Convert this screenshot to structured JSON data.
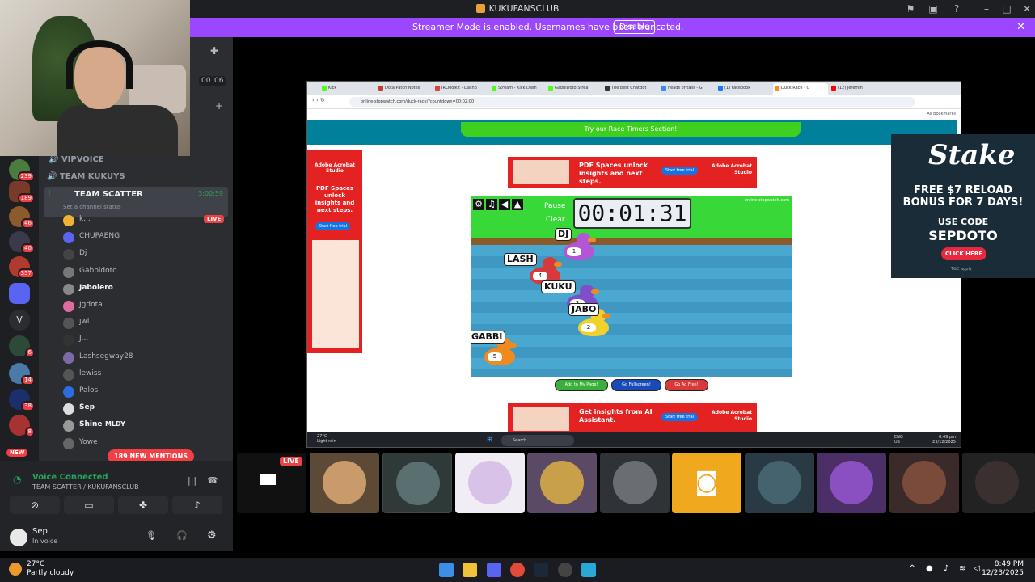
{
  "window": {
    "title": "KUKUFANSCLUB"
  },
  "banner": {
    "message": "Streamer Mode is enabled. Usernames have been truncated.",
    "disable_label": "Disable"
  },
  "server_rail": {
    "badges": [
      "239",
      "189",
      "46",
      "40",
      "357",
      "6",
      "14",
      "38",
      "8"
    ],
    "letter_server": "V",
    "new_label": "NEW"
  },
  "channels": {
    "timer_digits": [
      "00",
      "06"
    ],
    "categories": [
      {
        "name": "VIPVOICE"
      },
      {
        "name": "TEAM KUKUYS"
      }
    ],
    "active_channel": {
      "name": "TEAM SCATTER",
      "time": "3:00:59",
      "status": "Set a channel status"
    },
    "members": [
      {
        "name": "k...",
        "live": "LIVE",
        "color": "#f0b232",
        "bold": false
      },
      {
        "name": "CHUPAENG",
        "color": "#5865f2",
        "bold": false
      },
      {
        "name": "Dj",
        "color": "#444",
        "bold": false
      },
      {
        "name": "Gabbidoto",
        "color": "#777",
        "bold": false
      },
      {
        "name": "Jabolero",
        "color": "#888",
        "bold": true
      },
      {
        "name": "Jgdota",
        "color": "#e06c9f",
        "bold": false
      },
      {
        "name": "jwl",
        "color": "#555",
        "bold": false
      },
      {
        "name": "J...",
        "color": "#333",
        "bold": false
      },
      {
        "name": "Lashsegway28",
        "color": "#7b6aa5",
        "bold": false
      },
      {
        "name": "lewiss",
        "color": "#555",
        "bold": false
      },
      {
        "name": "Palos",
        "color": "#2d6cdf",
        "bold": false
      },
      {
        "name": "Sep",
        "color": "#ddd",
        "bold": true
      },
      {
        "name": "Shine",
        "tag": "MLDY",
        "color": "#999",
        "bold": true
      },
      {
        "name": "Yowe",
        "color": "#666",
        "bold": false
      }
    ],
    "mentions": "189 NEW MENTIONS"
  },
  "voice": {
    "status": "Voice Connected",
    "server": "TEAM SCATTER / KUKUFANSCLUB",
    "user": "Sep",
    "user_status": "In voice"
  },
  "browser": {
    "tabs": [
      "Kick",
      "Dota Patch Notes",
      "IRLToolkit - Dashb",
      "Stream - Kick Dash",
      "GabbiDoto Strea",
      "The best ChatBot",
      "heads or tails - G",
      "(1) Facebook",
      "Duck Race - O",
      "(12) Jeremih"
    ],
    "url": "online-stopwatch.com/duck-race/?countdown=00:02:00",
    "bookmarks_label": "All Bookmarks",
    "try_button": "Try our Race Timers Section!",
    "top_ad": {
      "headline": "PDF Spaces unlock insights and next steps.",
      "cta": "Start free trial",
      "brand": "Adobe Acrobat Studio"
    },
    "side_ad": {
      "brand": "Adobe Acrobat Studio",
      "headline": "PDF Spaces unlock insights and next steps.",
      "cta": "Start free trial"
    },
    "bottom_ad": {
      "headline": "Get insights from AI Assistant.",
      "cta": "Start free trial",
      "brand": "Adobe Acrobat Studio"
    },
    "game": {
      "pause": "Pause",
      "clear": "Clear",
      "timer": "00:01:31",
      "site": "online-stopwatch.com",
      "ducks": [
        {
          "label": "DJ",
          "num": "1",
          "color": "#b455d8"
        },
        {
          "label": "LASH",
          "num": "4",
          "color": "#d63a3a"
        },
        {
          "label": "KUKU",
          "num": "3",
          "color": "#7e4fc9"
        },
        {
          "label": "JABO",
          "num": "2",
          "color": "#f1d12a"
        },
        {
          "label": "GABBI",
          "num": "5",
          "color": "#f08a1c"
        }
      ],
      "buttons": [
        "Add to My Page!",
        "Go Fullscreen!",
        "Go Ad Free!"
      ]
    },
    "taskbar": {
      "weather_temp": "27°C",
      "weather_desc": "Light rain",
      "search": "Search",
      "lang": "ENG US",
      "time": "8:49 pm",
      "date": "23/12/2025"
    }
  },
  "stake_ad": {
    "logo": "Stake",
    "headline": "FREE $7 RELOAD BONUS FOR 7 DAYS!",
    "code_label": "USE CODE",
    "code": "SEPDOTO",
    "cta": "CLICK HERE",
    "terms": "T&C apply"
  },
  "stream_badge": "LIVE",
  "taskbar": {
    "weather_temp": "27°C",
    "weather_desc": "Partly cloudy",
    "time": "8:49 PM",
    "date": "12/23/2025"
  }
}
